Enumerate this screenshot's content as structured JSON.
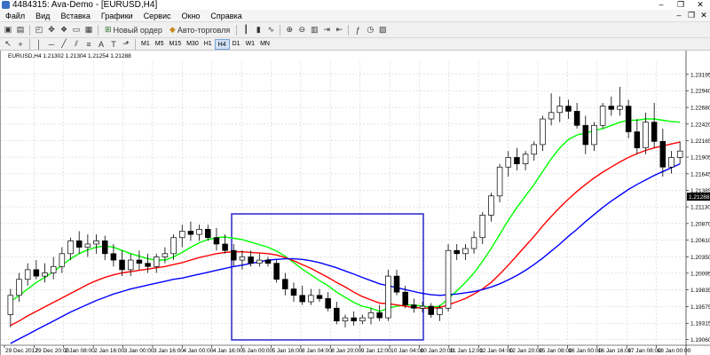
{
  "window": {
    "title": "4484315: Ava-Demo - [EURUSD,H4]",
    "buttons": [
      "–",
      "❐",
      "✕"
    ]
  },
  "menu": [
    "Файл",
    "Вид",
    "Вставка",
    "Графики",
    "Сервис",
    "Окно",
    "Справка"
  ],
  "toolbar": {
    "new_order": "Новый ордер",
    "auto_trading": "Авто-торговля"
  },
  "timeframes": [
    "M1",
    "M5",
    "M15",
    "M30",
    "H1",
    "H4",
    "D1",
    "W1",
    "MN"
  ],
  "active_timeframe": "H4",
  "chart_info": "EURUSD,H4  1.21302 1.21304 1.21254 1.21288",
  "colors": {
    "ma_fast": "#00ff00",
    "ma_mid": "#ff0000",
    "ma_slow": "#0000ff",
    "bull": "#ffffff",
    "bear": "#000000",
    "price_tag": "#000000",
    "box": "#3333cc"
  },
  "chart_data": {
    "type": "candlestick",
    "symbol": "EURUSD",
    "timeframe": "H4",
    "ylim": [
      1.19,
      1.234
    ],
    "price_ticks": [
      "1.23195",
      "1.22940",
      "1.22680",
      "1.22420",
      "1.22165",
      "1.21905",
      "1.21645",
      "1.21385",
      "1.21288",
      "1.21130",
      "1.20870",
      "1.20610",
      "1.20350",
      "1.20095",
      "1.19835",
      "1.19575",
      "1.19315",
      "1.19060"
    ],
    "current_price": "1.21288",
    "time_labels": [
      "29 Dec 2017",
      "29 Dec 20:00",
      "2 Jan 08:00",
      "2 Jan 16:00",
      "3 Jan 00:00",
      "3 Jan 16:00",
      "4 Jan 00:00",
      "4 Jan 16:00",
      "5 Jan 00:00",
      "5 Jan 16:00",
      "8 Jan 04:00",
      "8 Jan 20:00",
      "9 Jan 12:00",
      "10 Jan 04:00",
      "10 Jan 20:00",
      "11 Jan 12:00",
      "12 Jan 04:00",
      "12 Jan 20:00",
      "15 Jan 08:00",
      "16 Jan 00:00",
      "16 Jan 16:00",
      "17 Jan 08:00",
      "18 Jan 00:00"
    ],
    "candles": [
      [
        1.1945,
        1.1985,
        1.1925,
        1.1975
      ],
      [
        1.1975,
        1.201,
        1.1965,
        1.2
      ],
      [
        1.2,
        1.2025,
        1.199,
        1.2015
      ],
      [
        1.2015,
        1.203,
        1.2,
        1.2005
      ],
      [
        1.2005,
        1.2025,
        1.1995,
        1.201
      ],
      [
        1.201,
        1.2035,
        1.2,
        1.202
      ],
      [
        1.202,
        1.205,
        1.201,
        1.204
      ],
      [
        1.204,
        1.2065,
        1.203,
        1.206
      ],
      [
        1.206,
        1.2075,
        1.204,
        1.205
      ],
      [
        1.205,
        1.207,
        1.2035,
        1.2055
      ],
      [
        1.2055,
        1.207,
        1.204,
        1.206
      ],
      [
        1.206,
        1.2068,
        1.203,
        1.204
      ],
      [
        1.204,
        1.2055,
        1.202,
        1.203
      ],
      [
        1.203,
        1.2045,
        1.2005,
        1.2015
      ],
      [
        1.2015,
        1.204,
        1.2005,
        1.203
      ],
      [
        1.203,
        1.2045,
        1.2015,
        1.2025
      ],
      [
        1.2025,
        1.204,
        1.201,
        1.202
      ],
      [
        1.202,
        1.204,
        1.201,
        1.2035
      ],
      [
        1.2035,
        1.205,
        1.2025,
        1.204
      ],
      [
        1.204,
        1.207,
        1.203,
        1.2065
      ],
      [
        1.2065,
        1.2085,
        1.205,
        1.2075
      ],
      [
        1.2075,
        1.209,
        1.206,
        1.207
      ],
      [
        1.207,
        1.2085,
        1.206,
        1.2078
      ],
      [
        1.2078,
        1.2085,
        1.206,
        1.2065
      ],
      [
        1.2065,
        1.208,
        1.2045,
        1.2055
      ],
      [
        1.2055,
        1.207,
        1.204,
        1.2045
      ],
      [
        1.2045,
        1.2055,
        1.202,
        1.203
      ],
      [
        1.203,
        1.2045,
        1.2015,
        1.2035
      ],
      [
        1.2035,
        1.2045,
        1.202,
        1.2025
      ],
      [
        1.2025,
        1.204,
        1.202,
        1.203
      ],
      [
        1.203,
        1.2035,
        1.202,
        1.2025
      ],
      [
        1.2025,
        1.203,
        1.1995,
        1.2
      ],
      [
        1.2,
        1.201,
        1.1975,
        1.1985
      ],
      [
        1.1985,
        1.1995,
        1.1965,
        1.1975
      ],
      [
        1.1975,
        1.199,
        1.196,
        1.1965
      ],
      [
        1.1965,
        1.1985,
        1.196,
        1.1975
      ],
      [
        1.1975,
        1.1985,
        1.1965,
        1.197
      ],
      [
        1.197,
        1.198,
        1.195,
        1.1955
      ],
      [
        1.1955,
        1.1965,
        1.193,
        1.1935
      ],
      [
        1.1935,
        1.1945,
        1.1925,
        1.194
      ],
      [
        1.194,
        1.195,
        1.1928,
        1.1935
      ],
      [
        1.1935,
        1.1945,
        1.193,
        1.194
      ],
      [
        1.194,
        1.1955,
        1.193,
        1.1948
      ],
      [
        1.1948,
        1.196,
        1.1935,
        1.194
      ],
      [
        1.194,
        1.2015,
        1.1935,
        1.2005
      ],
      [
        1.2005,
        1.2015,
        1.1975,
        1.198
      ],
      [
        1.198,
        1.199,
        1.1955,
        1.196
      ],
      [
        1.196,
        1.197,
        1.1948,
        1.1955
      ],
      [
        1.1955,
        1.1965,
        1.1948,
        1.1958
      ],
      [
        1.1958,
        1.1963,
        1.194,
        1.1945
      ],
      [
        1.1945,
        1.196,
        1.1935,
        1.1955
      ],
      [
        1.1955,
        1.2055,
        1.195,
        1.2045
      ],
      [
        1.2045,
        1.2055,
        1.203,
        1.204
      ],
      [
        1.204,
        1.2055,
        1.203,
        1.2048
      ],
      [
        1.2048,
        1.2075,
        1.204,
        1.2065
      ],
      [
        1.2065,
        1.2105,
        1.2055,
        1.21
      ],
      [
        1.21,
        1.2135,
        1.209,
        1.213
      ],
      [
        1.213,
        1.218,
        1.212,
        1.2175
      ],
      [
        1.2175,
        1.22,
        1.216,
        1.219
      ],
      [
        1.219,
        1.2205,
        1.217,
        1.218
      ],
      [
        1.218,
        1.22,
        1.217,
        1.2195
      ],
      [
        1.2195,
        1.2215,
        1.2185,
        1.221
      ],
      [
        1.221,
        1.2255,
        1.22,
        1.225
      ],
      [
        1.225,
        1.229,
        1.224,
        1.226
      ],
      [
        1.226,
        1.2285,
        1.2245,
        1.227
      ],
      [
        1.227,
        1.228,
        1.225,
        1.2262
      ],
      [
        1.2262,
        1.2275,
        1.2235,
        1.224
      ],
      [
        1.224,
        1.2255,
        1.2195,
        1.221
      ],
      [
        1.221,
        1.2245,
        1.22,
        1.224
      ],
      [
        1.224,
        1.2275,
        1.2235,
        1.227
      ],
      [
        1.227,
        1.2285,
        1.2255,
        1.2265
      ],
      [
        1.2265,
        1.23,
        1.2255,
        1.227
      ],
      [
        1.227,
        1.228,
        1.222,
        1.223
      ],
      [
        1.223,
        1.225,
        1.2195,
        1.2205
      ],
      [
        1.2205,
        1.226,
        1.2195,
        1.2245
      ],
      [
        1.2245,
        1.2275,
        1.2205,
        1.2215
      ],
      [
        1.2215,
        1.2235,
        1.216,
        1.2175
      ],
      [
        1.2175,
        1.22,
        1.2165,
        1.219
      ],
      [
        1.219,
        1.2215,
        1.218,
        1.22
      ]
    ],
    "ma_fast": [
      1.1965,
      1.1975,
      1.1985,
      1.1995,
      1.2003,
      1.2012,
      1.2022,
      1.2032,
      1.204,
      1.2046,
      1.205,
      1.2052,
      1.205,
      1.2045,
      1.204,
      1.2036,
      1.2032,
      1.203,
      1.203,
      1.2035,
      1.2042,
      1.205,
      1.2057,
      1.2062,
      1.2065,
      1.2066,
      1.2064,
      1.2062,
      1.2058,
      1.2054,
      1.205,
      1.2044,
      1.2036,
      1.2026,
      1.2016,
      1.2007,
      1.1998,
      1.199,
      1.198,
      1.1972,
      1.1964,
      1.1958,
      1.1955,
      1.195,
      1.1955,
      1.1958,
      1.196,
      1.196,
      1.1958,
      1.1957,
      1.1958,
      1.197,
      1.1982,
      1.1995,
      1.201,
      1.2028,
      1.2048,
      1.207,
      1.2092,
      1.2112,
      1.213,
      1.2148,
      1.2168,
      1.2188,
      1.2205,
      1.2218,
      1.2225,
      1.2228,
      1.2232,
      1.2235,
      1.224,
      1.2245,
      1.2248,
      1.2248,
      1.225,
      1.225,
      1.2248,
      1.2246,
      1.2245
    ],
    "ma_mid": [
      1.1928,
      1.1935,
      1.1943,
      1.195,
      1.1957,
      1.1964,
      1.1971,
      1.1978,
      1.1985,
      1.1992,
      1.1998,
      1.2003,
      1.2007,
      1.201,
      1.2012,
      1.2014,
      1.2016,
      1.2018,
      1.202,
      1.2023,
      1.2026,
      1.203,
      1.2034,
      1.2037,
      1.204,
      1.2042,
      1.2043,
      1.2043,
      1.2042,
      1.2041,
      1.204,
      1.2038,
      1.2034,
      1.2029,
      1.2023,
      1.2017,
      1.201,
      1.2003,
      1.1995,
      1.1988,
      1.198,
      1.1973,
      1.1968,
      1.1963,
      1.1962,
      1.196,
      1.1958,
      1.1956,
      1.1955,
      1.1955,
      1.1956,
      1.196,
      1.1965,
      1.197,
      1.1977,
      1.1985,
      1.1995,
      1.2008,
      1.2022,
      1.2037,
      1.2052,
      1.2067,
      1.2083,
      1.2098,
      1.2112,
      1.2125,
      1.2137,
      1.2148,
      1.2158,
      1.2167,
      1.2175,
      1.2183,
      1.219,
      1.2196,
      1.2201,
      1.2205,
      1.2208,
      1.2211,
      1.2214
    ],
    "ma_slow": [
      1.19,
      1.1907,
      1.1914,
      1.1921,
      1.1928,
      1.1935,
      1.1942,
      1.1949,
      1.1955,
      1.1961,
      1.1967,
      1.1972,
      1.1977,
      1.1981,
      1.1985,
      1.1988,
      1.1991,
      1.1994,
      1.1997,
      1.2,
      1.2002,
      1.2005,
      1.2008,
      1.2011,
      1.2014,
      1.2017,
      1.202,
      1.2022,
      1.2025,
      1.2027,
      1.203,
      1.2031,
      1.2032,
      1.2032,
      1.2031,
      1.2029,
      1.2026,
      1.2022,
      1.2018,
      1.2013,
      1.2008,
      1.2003,
      1.1998,
      1.1993,
      1.199,
      1.1987,
      1.1984,
      1.1981,
      1.1978,
      1.1976,
      1.1975,
      1.1976,
      1.1977,
      1.1979,
      1.1981,
      1.1984,
      1.1988,
      1.1993,
      1.1999,
      1.2006,
      1.2014,
      1.2023,
      1.2033,
      1.2044,
      1.2055,
      1.2067,
      1.2078,
      1.209,
      1.2101,
      1.2112,
      1.2122,
      1.2131,
      1.214,
      1.2148,
      1.2155,
      1.2162,
      1.2168,
      1.2174,
      1.218
    ]
  }
}
